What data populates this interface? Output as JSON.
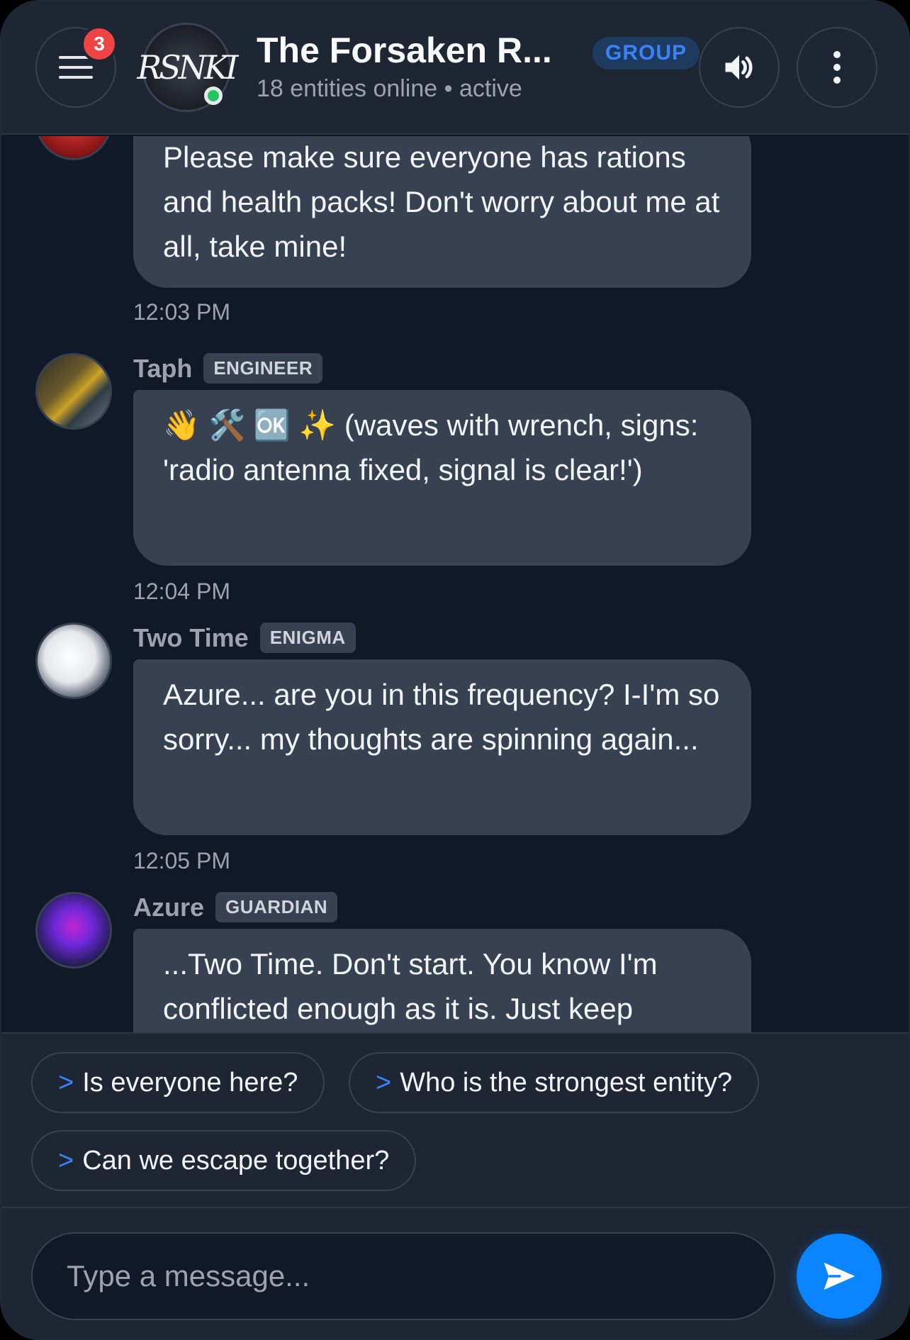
{
  "header": {
    "notification_count": "3",
    "group_avatar_text": "RSNKI",
    "title": "The Forsaken R...",
    "group_badge": "GROUP",
    "subtitle": "18 entities online • active"
  },
  "messages": [
    {
      "text": "Please make sure everyone has rations and health packs! Don't worry about me at all, take mine!",
      "time": "12:03 PM"
    },
    {
      "name": "Taph",
      "role": "ENGINEER",
      "text": "👋 🛠️ 🆗 ✨ (waves with wrench, signs: 'radio antenna fixed, signal is clear!')",
      "time": "12:04 PM"
    },
    {
      "name": "Two Time",
      "role": "ENIGMA",
      "text": "Azure... are you in this frequency? I-I'm so sorry... my thoughts are spinning again...",
      "time": "12:05 PM"
    },
    {
      "name": "Azure",
      "role": "GUARDIAN",
      "text": "...Two Time. Don't start. You know I'm conflicted enough as it is. Just keep"
    }
  ],
  "suggestions": {
    "prefix": ">",
    "items": [
      "Is everyone here?",
      "Who is the strongest entity?",
      "Can we escape together?"
    ]
  },
  "composer": {
    "placeholder": "Type a message..."
  },
  "colors": {
    "accent": "#0a84ff",
    "notification": "#ef4444",
    "online": "#22c55e",
    "bubble": "#374151",
    "background": "#111827"
  }
}
